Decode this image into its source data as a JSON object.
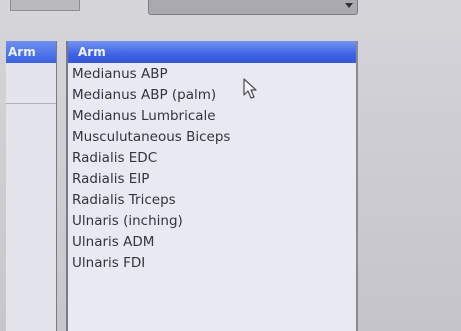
{
  "left_panel": {
    "header_label": "Arm"
  },
  "arm_panel": {
    "header_label": "Arm",
    "items": [
      "Medianus ABP",
      "Medianus ABP (palm)",
      "Medianus Lumbricale",
      "Musculutaneous Biceps",
      "Radialis EDC",
      "Radialis EIP",
      "Radialis Triceps",
      "Ulnaris (inching)",
      "Ulnaris ADM",
      "Ulnaris FDI"
    ]
  },
  "colors": {
    "header_blue": "#3e63e4",
    "list_background": "#e9e9f1",
    "item_text": "#343440"
  },
  "icons": {
    "cursor": "mouse-pointer-icon",
    "dropdown": "chevron-down-icon"
  }
}
